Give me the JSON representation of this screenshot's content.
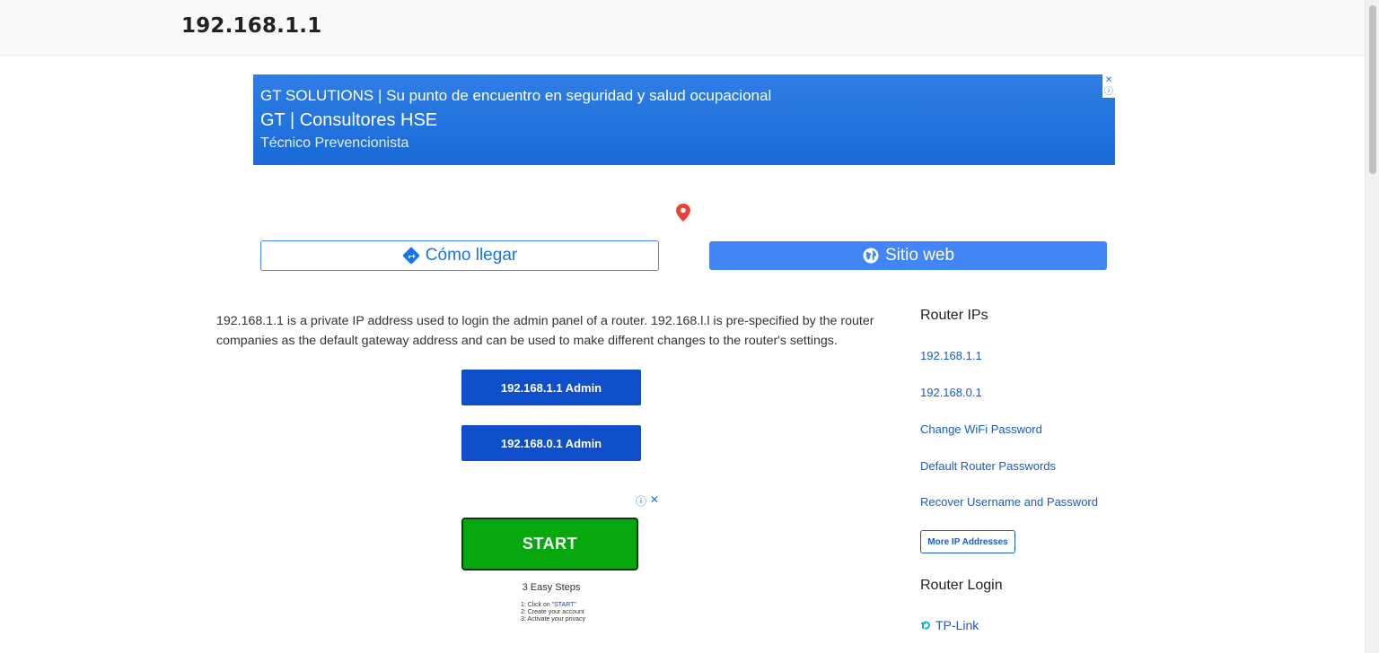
{
  "header": {
    "title": "192.168.1.1"
  },
  "ad_banner": {
    "line1": "GT SOLUTIONS | Su punto de encuentro en seguridad y salud ocupacional",
    "line2": "GT | Consultores HSE",
    "line3": "Técnico Prevencionista",
    "close_glyph": "✕",
    "info_glyph": "ⓘ"
  },
  "location": {
    "directions_label": "Cómo llegar",
    "website_label": "Sitio web",
    "directions_icon": "directions-icon",
    "website_icon": "globe-icon",
    "pin_icon": "map-pin-icon"
  },
  "main": {
    "intro": "192.168.1.1 is a private IP address used to login the admin panel of a router. 192.168.l.l is pre-specified by the router companies as the default gateway address and can be used to make different changes to the router's settings.",
    "admin_buttons": [
      "192.168.1.1 Admin",
      "192.168.0.1 Admin"
    ]
  },
  "ad2": {
    "info_glyph": "ⓘ",
    "close_glyph": "✕",
    "start_label": "START",
    "steps_title": "3 Easy Steps",
    "step1_prefix": "1: Click on ",
    "step1_highlight": "\"START\"",
    "step2": "2: Create your account",
    "step3": "3: Activate your privacy"
  },
  "sidebar": {
    "router_ips_title": "Router IPs",
    "links": [
      "192.168.1.1",
      "192.168.0.1",
      "Change WiFi Password",
      "Default Router Passwords",
      "Recover Username and Password"
    ],
    "more_button": "More IP Addresses",
    "router_login_title": "Router Login",
    "tp_link": "TP-Link"
  },
  "colors": {
    "accent_blue": "#4285f4",
    "admin_button": "#0f4fc9",
    "start_green": "#06a80e",
    "link": "#1a5bc4",
    "pin_red": "#ea4335"
  }
}
